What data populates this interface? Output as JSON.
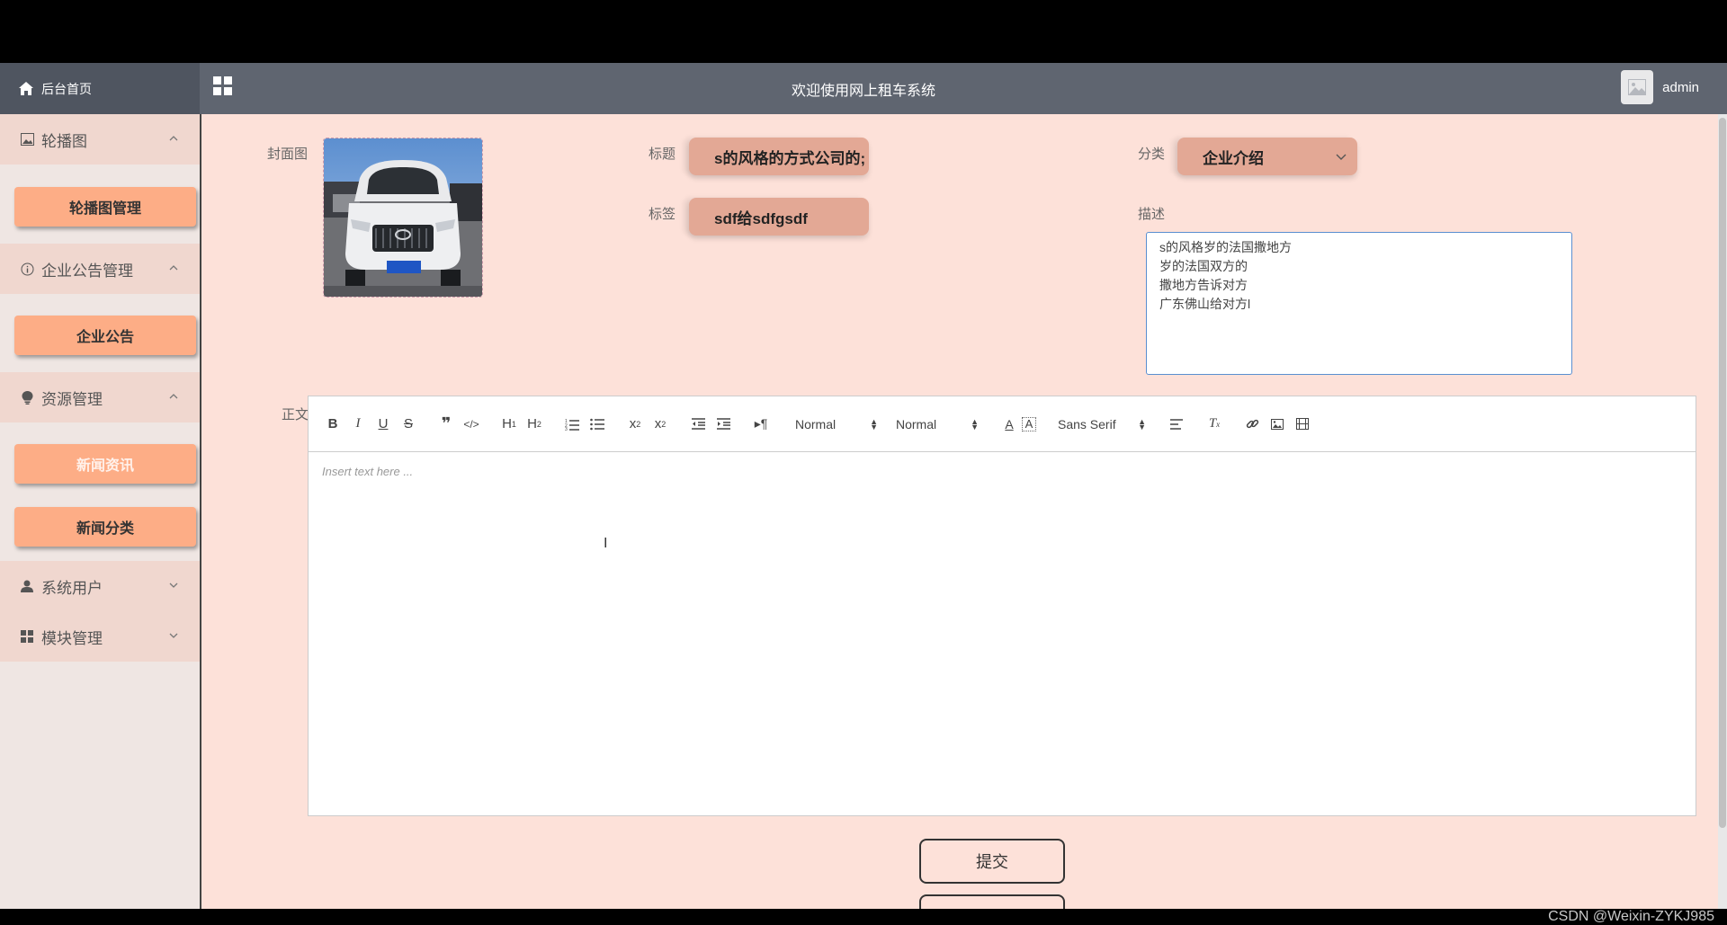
{
  "header": {
    "home_label": "后台首页",
    "title": "欢迎使用网上租车系统",
    "username": "admin"
  },
  "sidebar": {
    "groups": [
      {
        "label": "轮播图",
        "icon": "image-icon",
        "expanded": true,
        "items": [
          "轮播图管理"
        ]
      },
      {
        "label": "企业公告管理",
        "icon": "info-icon",
        "expanded": true,
        "items": [
          "企业公告"
        ]
      },
      {
        "label": "资源管理",
        "icon": "bulb-icon",
        "expanded": true,
        "items": [
          "新闻资讯",
          "新闻分类"
        ]
      },
      {
        "label": "系统用户",
        "icon": "user-icon",
        "expanded": false,
        "items": []
      },
      {
        "label": "模块管理",
        "icon": "grid-icon",
        "expanded": false,
        "items": []
      }
    ],
    "active_item": "新闻资讯"
  },
  "form": {
    "cover_label": "封面图",
    "title_label": "标题",
    "title_value": "s的风格的方式公司的;",
    "category_label": "分类",
    "category_value": "企业介绍",
    "tags_label": "标签",
    "tags_value": "sdf给sdfgsdf",
    "desc_label": "描述",
    "desc_value": "  s的风格岁的法国撒地方\n岁的法国双方的\n撒地方告诉对方\n广东佛山给对方l",
    "body_label": "正文",
    "editor_placeholder": "Insert text here ...",
    "submit_label": "提交"
  },
  "toolbar": {
    "header_select": "Normal",
    "size_select": "Normal",
    "font_select": "Sans Serif"
  },
  "watermark": "CSDN @Weixin-ZYKJ985"
}
